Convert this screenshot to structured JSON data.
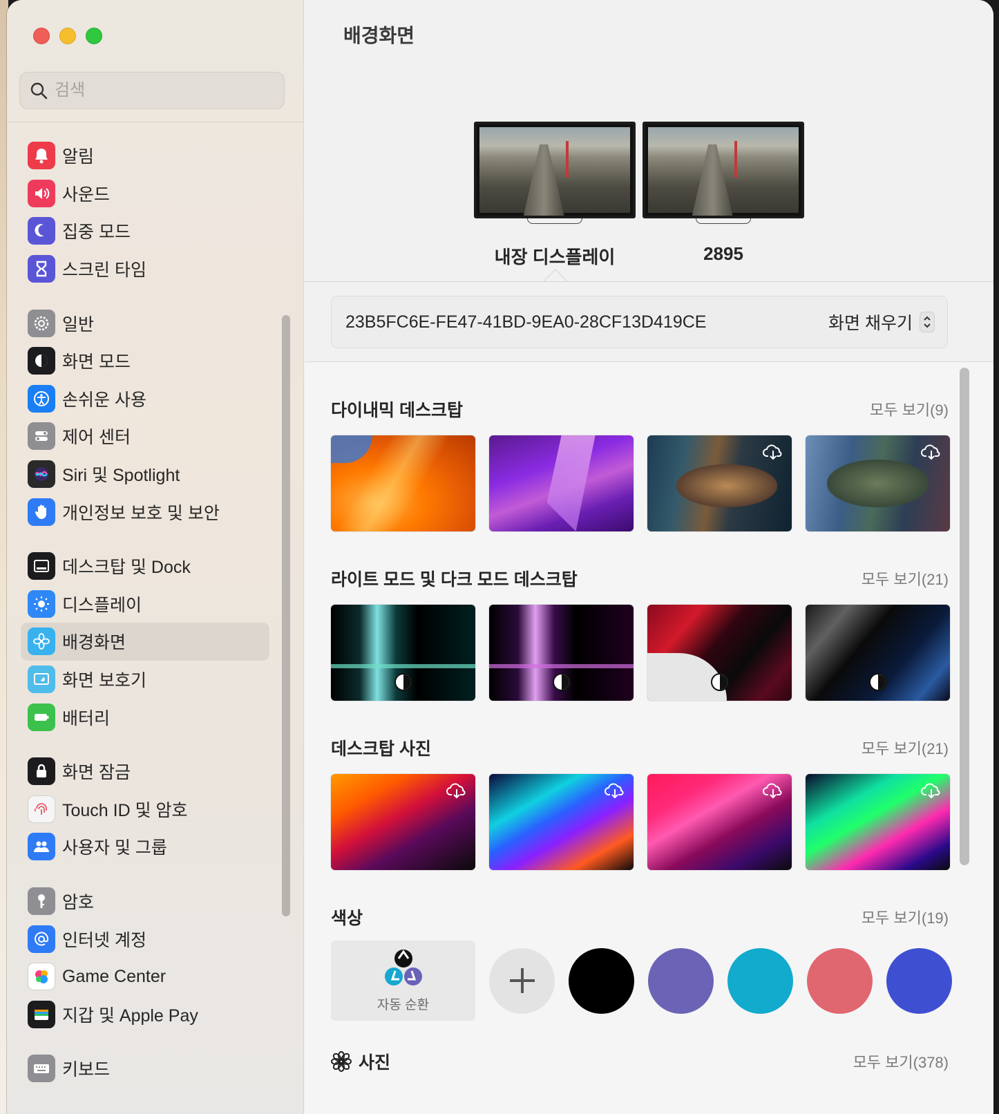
{
  "search": {
    "placeholder": "검색"
  },
  "sidebar": {
    "groups": [
      [
        {
          "label": "알림",
          "icon": "bell-icon",
          "color": "#ee3b4a"
        },
        {
          "label": "사운드",
          "icon": "speaker-icon",
          "color": "#ee3b5c"
        },
        {
          "label": "집중 모드",
          "icon": "moon-icon",
          "color": "#5a55d6"
        },
        {
          "label": "스크린 타임",
          "icon": "hourglass-icon",
          "color": "#5a55d6"
        }
      ],
      [
        {
          "label": "일반",
          "icon": "gear-icon",
          "color": "#8e8e93"
        },
        {
          "label": "화면 모드",
          "icon": "appearance-icon",
          "color": "#1c1c1e"
        },
        {
          "label": "손쉬운 사용",
          "icon": "accessibility-icon",
          "color": "#1a7ef5"
        },
        {
          "label": "제어 센터",
          "icon": "control-center-icon",
          "color": "#8e8e93"
        },
        {
          "label": "Siri 및 Spotlight",
          "icon": "siri-icon",
          "color": "#2a2a2a"
        },
        {
          "label": "개인정보 보호 및 보안",
          "icon": "hand-icon",
          "color": "#2f7bf5"
        }
      ],
      [
        {
          "label": "데스크탑 및 Dock",
          "icon": "dock-icon",
          "color": "#1c1c1e"
        },
        {
          "label": "디스플레이",
          "icon": "sun-icon",
          "color": "#2f88f5"
        },
        {
          "label": "배경화면",
          "icon": "flower-icon",
          "color": "#38b2ee",
          "selected": true
        },
        {
          "label": "화면 보호기",
          "icon": "screensaver-icon",
          "color": "#4fbcea"
        },
        {
          "label": "배터리",
          "icon": "battery-icon",
          "color": "#3cc24c"
        }
      ],
      [
        {
          "label": "화면 잠금",
          "icon": "lock-icon",
          "color": "#1c1c1e"
        },
        {
          "label": "Touch ID 및 암호",
          "icon": "fingerprint-icon",
          "color": "#f5f5f5"
        },
        {
          "label": "사용자 및 그룹",
          "icon": "users-icon",
          "color": "#2f7bf5"
        }
      ],
      [
        {
          "label": "암호",
          "icon": "key-icon",
          "color": "#8e8e93"
        },
        {
          "label": "인터넷 계정",
          "icon": "at-icon",
          "color": "#2f7bf5"
        },
        {
          "label": "Game Center",
          "icon": "game-center-icon",
          "color": "#ffffff"
        },
        {
          "label": "지갑 및 Apple Pay",
          "icon": "wallet-icon",
          "color": "#1c1c1e"
        }
      ],
      [
        {
          "label": "키보드",
          "icon": "keyboard-icon",
          "color": "#8e8e93"
        }
      ]
    ]
  },
  "main": {
    "title": "배경화면",
    "displays": [
      {
        "name": "내장 디스플레이"
      },
      {
        "name": "2895"
      }
    ],
    "wallpaper_id": "23B5FC6E-FE47-41BD-9EA0-28CF13D419CE",
    "fit_mode": "화면 채우기",
    "sections": {
      "dynamic": {
        "title": "다이내믹 데스크탑",
        "see_all": "모두 보기(9)"
      },
      "light_dark": {
        "title": "라이트 모드 및 다크 모드 데스크탑",
        "see_all": "모두 보기(21)"
      },
      "photos_desktop": {
        "title": "데스크탑 사진",
        "see_all": "모두 보기(21)"
      },
      "colors": {
        "title": "색상",
        "see_all": "모두 보기(19)",
        "auto_label": "자동 순환",
        "swatches": [
          "#000000",
          "#6b63b5",
          "#12aacd",
          "#e06670",
          "#3f4fd1"
        ]
      },
      "photos": {
        "title": "사진",
        "see_all": "모두 보기(378)"
      }
    }
  }
}
